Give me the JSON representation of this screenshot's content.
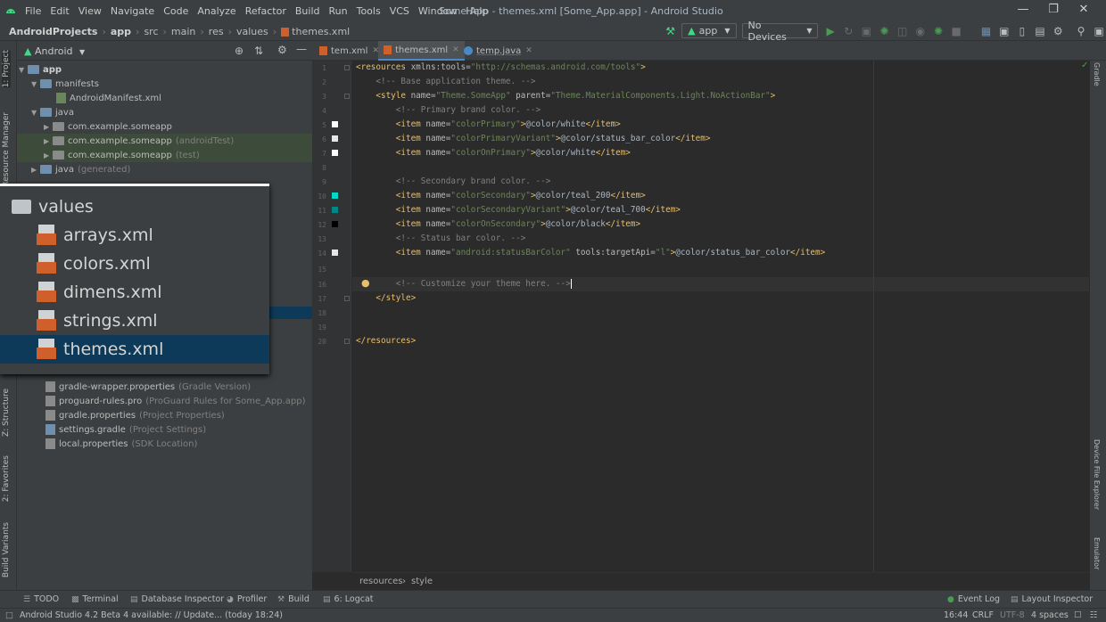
{
  "window": {
    "title": "Some App - themes.xml [Some_App.app] - Android Studio",
    "menu": [
      "File",
      "Edit",
      "View",
      "Navigate",
      "Code",
      "Analyze",
      "Refactor",
      "Build",
      "Run",
      "Tools",
      "VCS",
      "Window",
      "Help"
    ]
  },
  "breadcrumb": [
    "AndroidProjects",
    "app",
    "src",
    "main",
    "res",
    "values",
    "themes.xml"
  ],
  "run_toolbar": {
    "config": "app",
    "device": "No Devices"
  },
  "left_strip": [
    "1: Project",
    "Resource Manager",
    "Z: Structure",
    "2: Favorites",
    "Build Variants"
  ],
  "project_panel": {
    "view_mode": "Android",
    "tree": [
      {
        "label": "app",
        "hint": ""
      },
      {
        "label": "manifests",
        "hint": ""
      },
      {
        "label": "AndroidManifest.xml",
        "hint": ""
      },
      {
        "label": "java",
        "hint": ""
      },
      {
        "label": "com.example.someapp",
        "hint": ""
      },
      {
        "label": "com.example.someapp",
        "hint": "(androidTest)"
      },
      {
        "label": "com.example.someapp",
        "hint": "(test)"
      },
      {
        "label": "java",
        "hint": "(generated)"
      },
      {
        "label": "gradle-wrapper.properties",
        "hint": "(Gradle Version)"
      },
      {
        "label": "proguard-rules.pro",
        "hint": "(ProGuard Rules for Some_App.app)"
      },
      {
        "label": "gradle.properties",
        "hint": "(Project Properties)"
      },
      {
        "label": "settings.gradle",
        "hint": "(Project Settings)"
      },
      {
        "label": "local.properties",
        "hint": "(SDK Location)"
      }
    ]
  },
  "zoom_popup": {
    "folder": "values",
    "files": [
      "arrays.xml",
      "colors.xml",
      "dimens.xml",
      "strings.xml",
      "themes.xml"
    ],
    "selected": "themes.xml"
  },
  "editor": {
    "tabs": [
      {
        "label": "tem.xml"
      },
      {
        "label": "themes.xml"
      },
      {
        "label": "temp.java"
      }
    ],
    "active_tab": "themes.xml",
    "lines": [
      "<resources xmlns:tools=\"http://schemas.android.com/tools\">",
      "    <!-- Base application theme. -->",
      "    <style name=\"Theme.SomeApp\" parent=\"Theme.MaterialComponents.Light.NoActionBar\">",
      "        <!-- Primary brand color. -->",
      "        <item name=\"colorPrimary\">@color/white</item>",
      "        <item name=\"colorPrimaryVariant\">@color/status_bar_color</item>",
      "        <item name=\"colorOnPrimary\">@color/white</item>",
      "",
      "        <!-- Secondary brand color. -->",
      "        <item name=\"colorSecondary\">@color/teal_200</item>",
      "        <item name=\"colorSecondaryVariant\">@color/teal_700</item>",
      "        <item name=\"colorOnSecondary\">@color/black</item>",
      "        <!-- Status bar color. -->",
      "        <item name=\"android:statusBarColor\" tools:targetApi=\"l\">@color/status_bar_color</item>",
      "",
      "        <!-- Customize your theme here. -->",
      "    </style>",
      "",
      "",
      "</resources>"
    ],
    "line_numbers": [
      "1",
      "2",
      "3",
      "4",
      "5",
      "6",
      "7",
      "8",
      "9",
      "10",
      "11",
      "12",
      "13",
      "14",
      "15",
      "16",
      "17",
      "18",
      "19",
      "20"
    ],
    "color_swatches": [
      {
        "line": 5,
        "color": "#ffffff"
      },
      {
        "line": 6,
        "color": "#e6e6e6"
      },
      {
        "line": 7,
        "color": "#ffffff"
      },
      {
        "line": 10,
        "color": "#03dac5"
      },
      {
        "line": 11,
        "color": "#018786"
      },
      {
        "line": 12,
        "color": "#000000"
      },
      {
        "line": 14,
        "color": "#e6e6e6"
      }
    ],
    "crumbs": [
      "resources",
      "style"
    ]
  },
  "right_strip": [
    "Gradle",
    "Device File Explorer",
    "Emulator"
  ],
  "bottom_tools": [
    "TODO",
    "Terminal",
    "Database Inspector",
    "Profiler",
    "Build",
    "6: Logcat",
    "Event Log",
    "Layout Inspector"
  ],
  "status": {
    "message": "Android Studio 4.2 Beta 4 available: // Update... (today 18:24)",
    "position": "16:44",
    "line_sep": "CRLF",
    "encoding": "UTF-8",
    "indent": "4 spaces"
  }
}
